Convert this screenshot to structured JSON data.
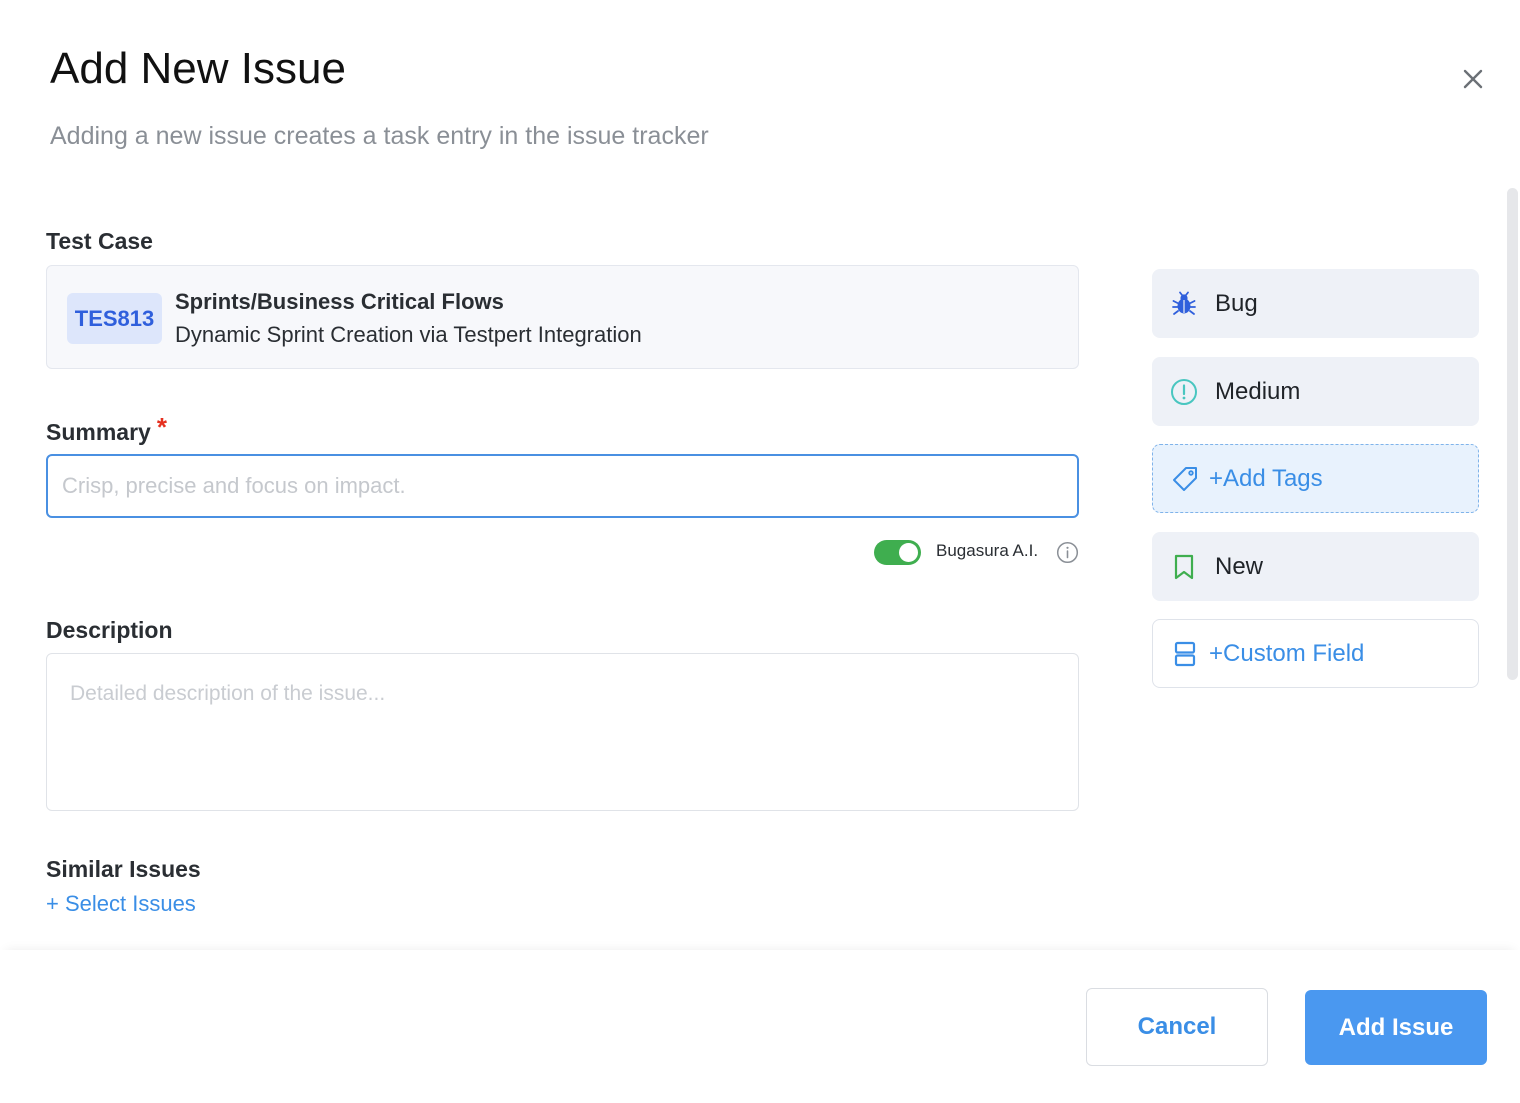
{
  "dialog": {
    "title": "Add New Issue",
    "subtitle": "Adding a new issue creates a task entry in the issue tracker"
  },
  "test_case": {
    "label": "Test Case",
    "id": "TES813",
    "path": "Sprints/Business Critical Flows",
    "name": "Dynamic Sprint Creation via Testpert Integration"
  },
  "summary": {
    "label": "Summary",
    "required_mark": "*",
    "value": "",
    "placeholder": "Crisp, precise and focus on impact."
  },
  "ai_toggle": {
    "label": "Bugasura A.I.",
    "enabled": true
  },
  "description": {
    "label": "Description",
    "value": "",
    "placeholder": "Detailed description of the issue..."
  },
  "similar_issues": {
    "label": "Similar Issues",
    "action": "+ Select Issues"
  },
  "side_panel": {
    "type": "Bug",
    "severity": "Medium",
    "tags": "+Add Tags",
    "status": "New",
    "custom_field": "+Custom Field"
  },
  "footer": {
    "cancel": "Cancel",
    "submit": "Add Issue"
  },
  "colors": {
    "accent": "#3a8ee6",
    "primary_button": "#4a98f0",
    "toggle_on": "#3fae4f",
    "required": "#e5301f",
    "badge_text": "#2f5fdc",
    "severity_icon": "#49c6c0",
    "status_icon": "#3fae4f",
    "bug_icon": "#2f5fdc"
  }
}
